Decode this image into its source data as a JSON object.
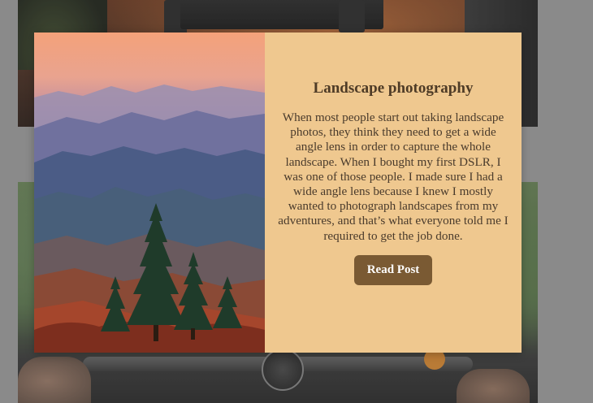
{
  "modal": {
    "title": "Landscape photography",
    "body": "When most people start out taking landscape photos, they think they need to get a wide angle lens in order to capture the whole landscape. When I bought my first DSLR, I was one of those people. I made sure I had a wide angle lens because I knew I mostly wanted to photograph landscapes from my adventures, and that’s what everyone told me I required to get the job done.",
    "button_label": "Read Post",
    "colors": {
      "panel": "#efc88f",
      "button": "#7a5a33",
      "text": "#4a3b2c"
    }
  },
  "background": {
    "images": [
      "desk-setup-photo",
      "motorcycle-handlebar-photo"
    ]
  }
}
